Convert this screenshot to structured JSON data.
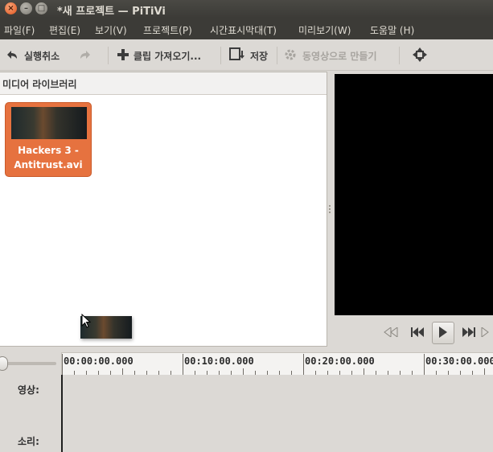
{
  "window": {
    "title": "*새 프로젝트 — PiTiVi",
    "close_glyph": "×",
    "min_glyph": "–",
    "max_glyph": "□"
  },
  "menu": [
    "파일(F)",
    "편집(E)",
    "보기(V)",
    "프로젝트(P)",
    "시간표시막대(T)",
    "미리보기(W)",
    "도움말 (H)"
  ],
  "toolbar": {
    "undo_label": "실행취소",
    "import_label": "클립 가져오기...",
    "save_label": "저장",
    "render_label": "동영상으로 만들기"
  },
  "library": {
    "header": "미디어 라이브러리",
    "clips": [
      {
        "name_line1": "Hackers 3 -",
        "name_line2": "Antitrust.avi"
      }
    ]
  },
  "timeline": {
    "ruler_labels": [
      "00:00:00.000",
      "00:10:00.000",
      "00:20:00.000",
      "00:30:00.000"
    ],
    "tracks": [
      "영상:",
      "소리:"
    ]
  },
  "colors": {
    "accent": "#e6723f",
    "titlebar": "#3c3b37",
    "window_bg": "#dcd9d5",
    "viewer_bg": "#000000"
  }
}
